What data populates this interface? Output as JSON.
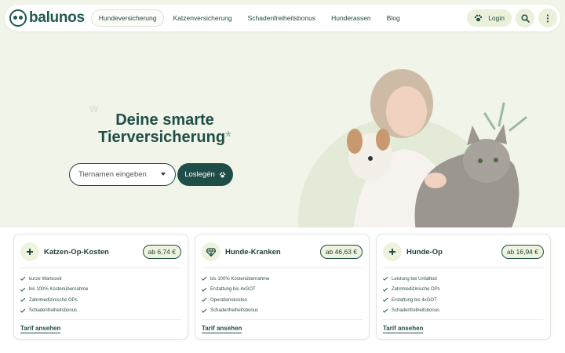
{
  "brand": {
    "name": "balunos"
  },
  "nav": {
    "items": [
      {
        "label": "Hundeversicherung",
        "active": true
      },
      {
        "label": "Katzenversicherung",
        "active": false
      },
      {
        "label": "Schadenfreiheitsbonus",
        "active": false
      },
      {
        "label": "Hunderassen",
        "active": false
      },
      {
        "label": "Blog",
        "active": false
      }
    ],
    "login_label": "Login",
    "icons": {
      "login": "paw-icon",
      "search": "search-icon",
      "menu": "more-vertical-icon"
    }
  },
  "hero": {
    "title_line1": "Deine smarte",
    "title_line2": "Tierversicherung",
    "asterisk": "*",
    "decor_letter": "W",
    "input_placeholder": "Tiernamen eingeben",
    "cta_label": "Loslegén",
    "cta_icon": "paw-icon"
  },
  "cards": [
    {
      "title": "Katzen-Op-Kosten",
      "price": "ab 6,74 €",
      "icon": "plus-icon",
      "features": [
        "kurze Wartezeit",
        "bis 100% Kostenübernahme",
        "Zahnmedizinische OPs",
        "Schadenfreiheitsbonus"
      ],
      "link": "Tarif ansehen"
    },
    {
      "title": "Hunde-Kranken",
      "price": "ab 46,63 €",
      "icon": "diamond-icon",
      "features": [
        "bis 100% Kostenübernahme",
        "Erstattung bis 4xGOT",
        "Operationskosten",
        "Schadenfreiheitsbonus"
      ],
      "link": "Tarif ansehen"
    },
    {
      "title": "Hunde-Op",
      "price": "ab 16,94 €",
      "icon": "plus-icon",
      "features": [
        "Leistung bei Unfalltod",
        "Zahnmedizinische OPs",
        "Erstattung bis 4xGOT",
        "Schadenfreiheitsbonus"
      ],
      "link": "Tarif ansehen"
    }
  ],
  "colors": {
    "primary": "#1f4e48",
    "accent_bg": "#eef3de",
    "page_bg": "#f1f4e8"
  }
}
